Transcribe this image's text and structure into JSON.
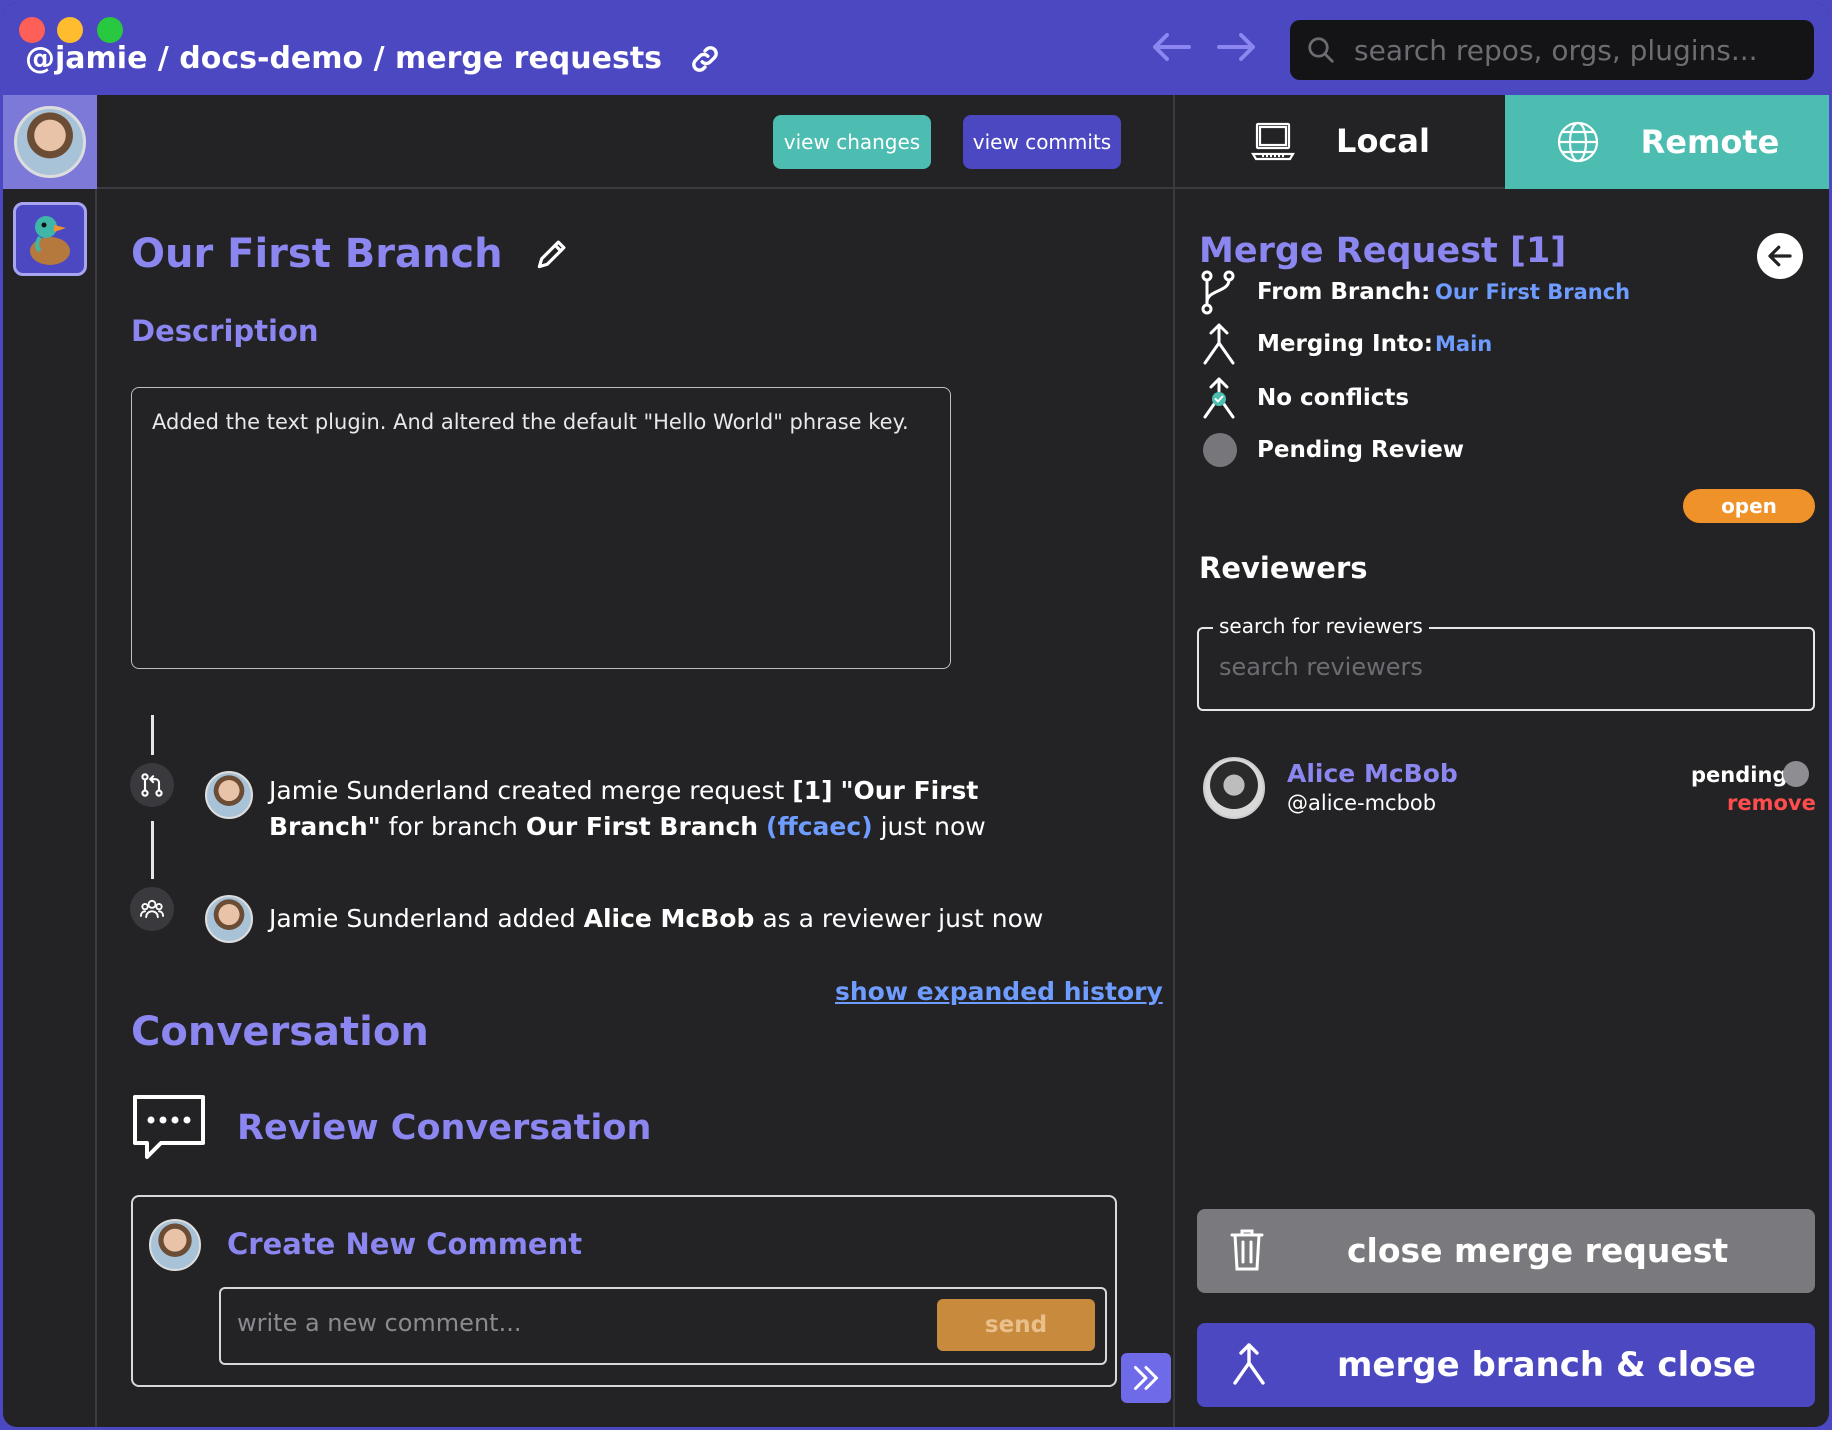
{
  "titlebar": {
    "breadcrumb": "@jamie / docs-demo / merge requests",
    "search_placeholder": "search repos, orgs, plugins..."
  },
  "toolbar": {
    "view_changes": "view changes",
    "view_commits": "view commits"
  },
  "tabs": {
    "local": "Local",
    "remote": "Remote"
  },
  "main": {
    "branch_title": "Our First Branch",
    "description_label": "Description",
    "description_text": "Added the text plugin. And altered the default \"Hello World\" phrase key.",
    "history": [
      {
        "actor": "Jamie Sunderland",
        "text_1": " created merge request ",
        "mr_number": "[1]",
        "mr_title": "\"Our First Branch\"",
        "text_2": " for branch ",
        "branch": "Our First Branch",
        "hash": "(ffcaec)",
        "time": " just now"
      },
      {
        "actor": "Jamie Sunderland",
        "text_1": " added ",
        "reviewer": "Alice McBob",
        "text_2": " as a reviewer just now"
      }
    ],
    "show_history": "show expanded history",
    "conversation_title": "Conversation",
    "review_conversation": "Review Conversation",
    "create_comment": "Create New Comment",
    "comment_placeholder": "write a new comment...",
    "send": "send"
  },
  "panel": {
    "title": "Merge Request [1]",
    "from_branch_label": "From Branch:",
    "from_branch_value": "Our First Branch",
    "merging_into_label": "Merging Into:",
    "merging_into_value": "Main",
    "conflicts": "No conflicts",
    "review_status": "Pending Review",
    "open_badge": "open",
    "reviewers_title": "Reviewers",
    "reviewer_search_legend": "search for reviewers",
    "reviewer_search_placeholder": "search reviewers",
    "reviewers": [
      {
        "name": "Alice McBob",
        "handle": "@alice-mcbob",
        "status": "pending",
        "remove": "remove"
      }
    ],
    "close_button": "close merge request",
    "merge_button": "merge branch & close"
  },
  "colors": {
    "accent_purple": "#4b48c1",
    "label_purple": "#8b86f0",
    "teal": "#4cbdb0",
    "link_blue": "#6f9cff",
    "open_orange": "#f0922a",
    "remove_red": "#ff4d4d",
    "background": "#232325"
  }
}
